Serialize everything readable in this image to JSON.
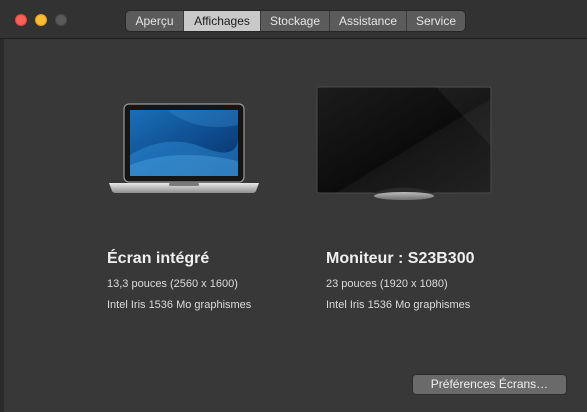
{
  "tabs": [
    {
      "label": "Aperçu",
      "active": false
    },
    {
      "label": "Affichages",
      "active": true
    },
    {
      "label": "Stockage",
      "active": false
    },
    {
      "label": "Assistance",
      "active": false
    },
    {
      "label": "Service",
      "active": false
    }
  ],
  "displays": [
    {
      "title": "Écran intégré",
      "size": "13,3 pouces (2560 x 1600)",
      "graphics": "Intel Iris 1536 Mo graphismes",
      "icon": "laptop-icon"
    },
    {
      "title": "Moniteur : S23B300",
      "size": "23 pouces (1920 x 1080)",
      "graphics": "Intel Iris 1536 Mo graphismes",
      "icon": "monitor-icon"
    }
  ],
  "button": {
    "label": "Préférences Écrans…"
  },
  "colors": {
    "close": "#fe5f57",
    "minimize": "#febc2e",
    "zoom_disabled": "#5a5a5a",
    "active_tab": "#c9c9c9",
    "background": "#383838"
  }
}
